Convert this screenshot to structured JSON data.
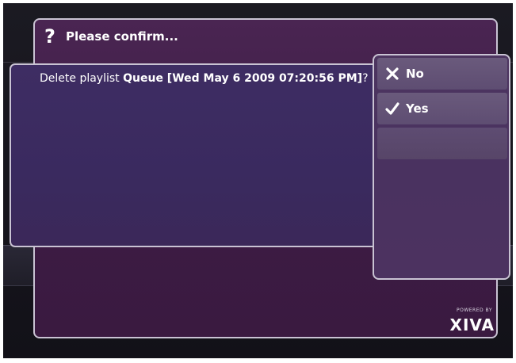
{
  "dialog": {
    "title": "Please confirm...",
    "message_prefix": "Delete playlist ",
    "message_bold": "Queue [Wed May 6 2009 07:20:56 PM]",
    "message_suffix": "?"
  },
  "options": [
    {
      "label": "No",
      "icon": "x-icon"
    },
    {
      "label": "Yes",
      "icon": "check-icon"
    },
    {
      "label": ""
    }
  ],
  "branding": {
    "powered_by": "POWERED BY",
    "logo": "XIVA"
  },
  "colors": {
    "panel": "#3d1c45",
    "message_panel": "#3a2a5f",
    "options_panel": "#4a3260",
    "border": "#c9c3d3"
  }
}
